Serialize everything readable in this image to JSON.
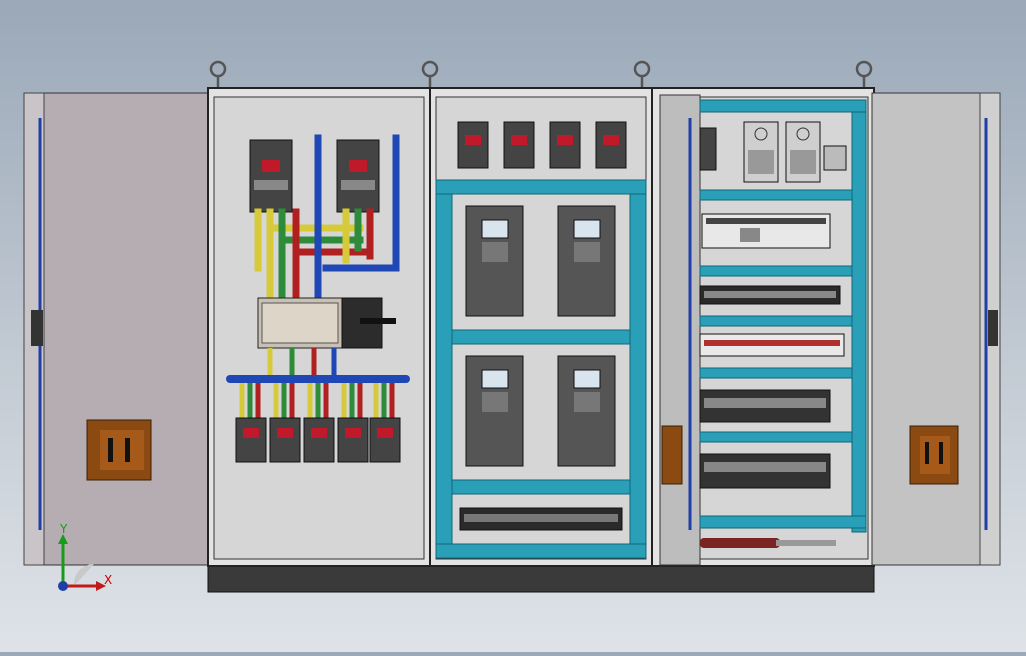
{
  "viewport": {
    "background_top": "#9aa8b8",
    "background_bottom": "#dfe3e8"
  },
  "assembly": {
    "panel_color": "#d5d5d5",
    "frame_color": "#222222",
    "plinth_color": "#3a3a3a",
    "busbar_colors": {
      "L1": "#d6c93a",
      "L2": "#2e8b3a",
      "L3": "#b02020",
      "N": "#1f47b5"
    },
    "din_rail_accent": "#2aa0b8",
    "door_color": "#bfbfbf",
    "handle_color": "#8a4a12",
    "rod_color": "#1f3fa8"
  },
  "triad": {
    "x_label": "X",
    "y_label": "Y"
  },
  "components": {
    "main_breakers": 2,
    "branch_breakers": 5,
    "drive_breakers": 4,
    "vfd_drives": 4,
    "power_supplies": 2,
    "terminal_strips": 6
  }
}
